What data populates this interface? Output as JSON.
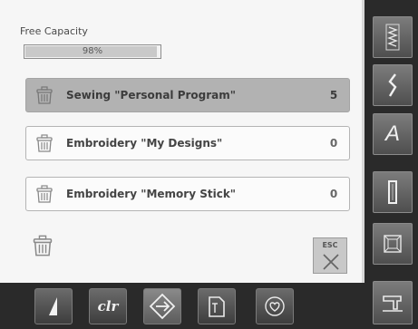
{
  "capacity": {
    "label": "Free Capacity",
    "percent_text": "98%",
    "fill_fraction": 0.98
  },
  "folders": [
    {
      "label": "Sewing \"Personal Program\"",
      "count": "5",
      "selected": true
    },
    {
      "label": "Embroidery \"My Designs\"",
      "count": "0",
      "selected": false
    },
    {
      "label": "Embroidery \"Memory Stick\"",
      "count": "0",
      "selected": false
    }
  ],
  "esc_button": {
    "label": "ESC"
  },
  "right_toolbar": {
    "items": [
      "stitch-pattern-icon",
      "zigzag-icon",
      "alphabet-icon",
      "buttonhole-icon",
      "quilt-icon",
      "sewing-machine-icon"
    ],
    "alphabet_glyph": "A"
  },
  "bottom_toolbar": {
    "items": [
      "needle-stop-icon",
      "clr-icon",
      "navigation-diamond-icon",
      "file-icon",
      "heart-icon"
    ],
    "clr_label": "clr",
    "active_item": "navigation-diamond-icon"
  },
  "colors": {
    "panel": "#f6f6f6",
    "selected_row": "#b2b2b2",
    "toolbar": "#2a2a2a"
  }
}
